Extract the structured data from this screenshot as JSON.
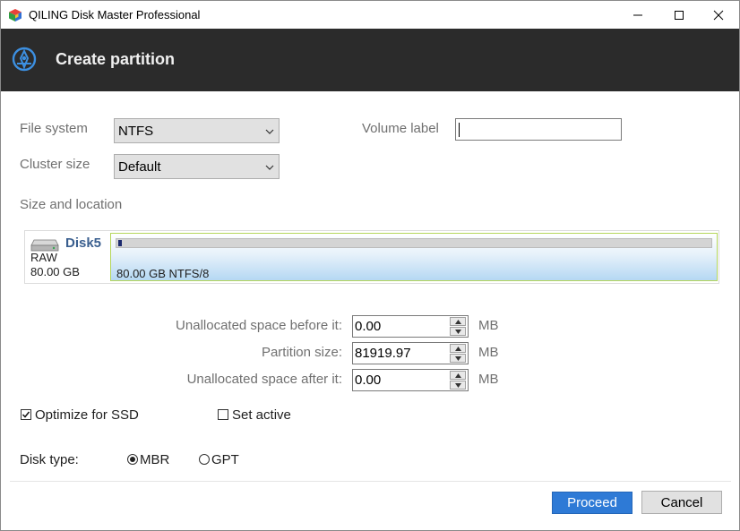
{
  "window": {
    "title": "QILING Disk Master Professional",
    "minimize_icon": "minimize-icon",
    "maximize_icon": "maximize-icon",
    "close_icon": "close-icon"
  },
  "header": {
    "title": "Create partition",
    "icon": "partition-wizard-icon",
    "background": "#2b2b2b"
  },
  "form": {
    "file_system_label": "File system",
    "file_system_value": "NTFS",
    "cluster_size_label": "Cluster size",
    "cluster_size_value": "Default",
    "volume_label_label": "Volume label",
    "volume_label_value": ""
  },
  "size_location": {
    "section_label": "Size and location",
    "disk_name": "Disk5",
    "disk_type_text": "RAW",
    "disk_capacity": "80.00 GB",
    "partition_label": "80.00 GB NTFS/8"
  },
  "sizes": {
    "before_label": "Unallocated space before it:",
    "before_value": "0.00",
    "partition_label": "Partition size:",
    "partition_value": "81919.97",
    "after_label": "Unallocated space after it:",
    "after_value": "0.00",
    "unit": "MB"
  },
  "options": {
    "optimize_ssd_label": "Optimize for SSD",
    "optimize_ssd_checked": true,
    "set_active_label": "Set active",
    "set_active_checked": false
  },
  "disk_type": {
    "label": "Disk type:",
    "mbr_label": "MBR",
    "gpt_label": "GPT",
    "selected": "MBR"
  },
  "actions": {
    "proceed_label": "Proceed",
    "cancel_label": "Cancel",
    "accent": "#2e7ad6"
  }
}
